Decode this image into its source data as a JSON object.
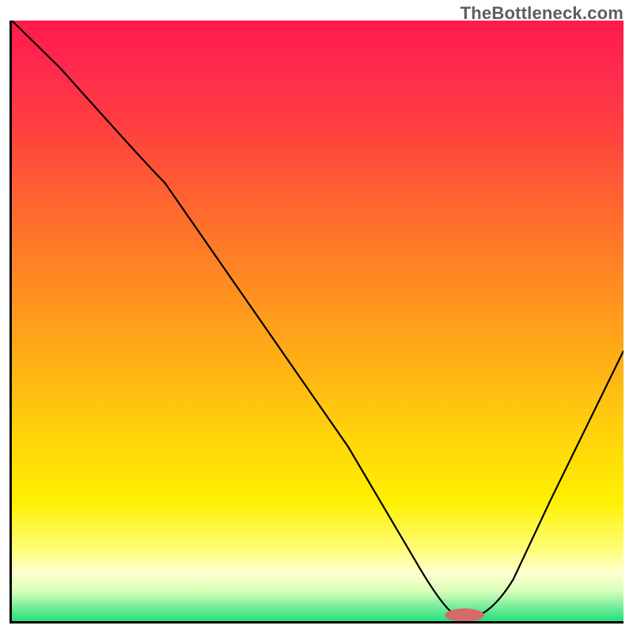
{
  "watermark": "TheBottleneck.com",
  "chart_data": {
    "type": "line",
    "title": "",
    "xlabel": "",
    "ylabel": "",
    "xlim": [
      0,
      100
    ],
    "ylim": [
      0,
      100
    ],
    "grid": false,
    "legend": false,
    "series": [
      {
        "name": "curve",
        "x": [
          0,
          8,
          25,
          40,
          55,
          66,
          70,
          76,
          80,
          88,
          100
        ],
        "y": [
          100,
          92,
          73,
          51,
          29,
          10,
          3,
          1,
          3,
          20,
          45
        ]
      }
    ],
    "marker": {
      "x": 74,
      "y": 1,
      "width": 6,
      "height": 2,
      "color": "#d46a6a"
    },
    "background_gradient": {
      "stops": [
        {
          "pct": 0,
          "color": "#ff1a4d"
        },
        {
          "pct": 50,
          "color": "#ffb000"
        },
        {
          "pct": 85,
          "color": "#ffff80"
        },
        {
          "pct": 100,
          "color": "#22e07a"
        }
      ]
    }
  }
}
